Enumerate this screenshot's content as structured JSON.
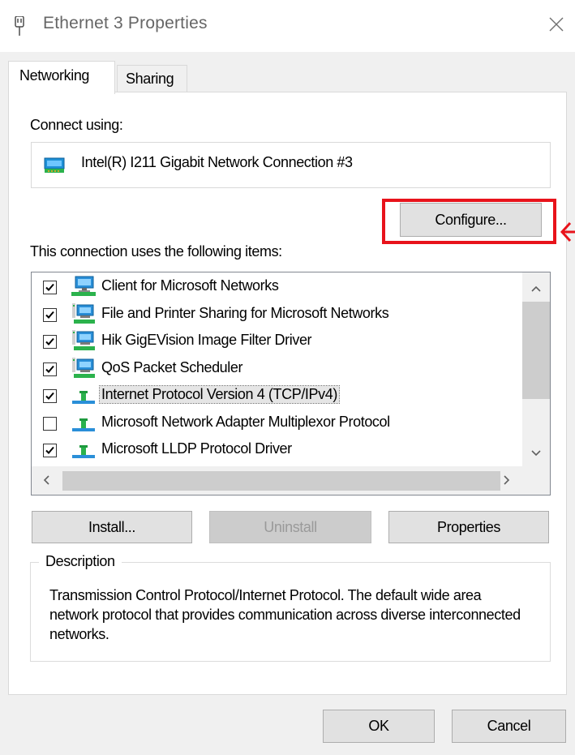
{
  "window": {
    "title": "Ethernet 3 Properties"
  },
  "tabs": [
    {
      "label": "Networking",
      "active": true
    },
    {
      "label": "Sharing",
      "active": false
    }
  ],
  "connect": {
    "label": "Connect using:",
    "adapter": "Intel(R) I211 Gigabit Network Connection #3",
    "configure_label": "Configure..."
  },
  "items": {
    "label": "This connection uses the following items:",
    "list": [
      {
        "label": "Client for Microsoft Networks",
        "checked": true,
        "icon": "client-network-icon",
        "selected": false
      },
      {
        "label": "File and Printer Sharing for Microsoft Networks",
        "checked": true,
        "icon": "service-network-icon",
        "selected": false
      },
      {
        "label": "Hik GigEVision Image Filter Driver",
        "checked": true,
        "icon": "service-network-icon",
        "selected": false
      },
      {
        "label": "QoS Packet Scheduler",
        "checked": true,
        "icon": "service-network-icon",
        "selected": false
      },
      {
        "label": "Internet Protocol Version 4 (TCP/IPv4)",
        "checked": true,
        "icon": "protocol-icon",
        "selected": true
      },
      {
        "label": "Microsoft Network Adapter Multiplexor Protocol",
        "checked": false,
        "icon": "protocol-icon",
        "selected": false
      },
      {
        "label": "Microsoft LLDP Protocol Driver",
        "checked": true,
        "icon": "protocol-icon",
        "selected": false
      }
    ]
  },
  "buttons": {
    "install": "Install...",
    "uninstall": "Uninstall",
    "properties": "Properties",
    "ok": "OK",
    "cancel": "Cancel"
  },
  "description": {
    "legend": "Description",
    "text": "Transmission Control Protocol/Internet Protocol. The default wide area network protocol that provides communication across diverse interconnected networks."
  },
  "colors": {
    "highlight": "#e8131b",
    "selection": "#e5e5e5"
  }
}
